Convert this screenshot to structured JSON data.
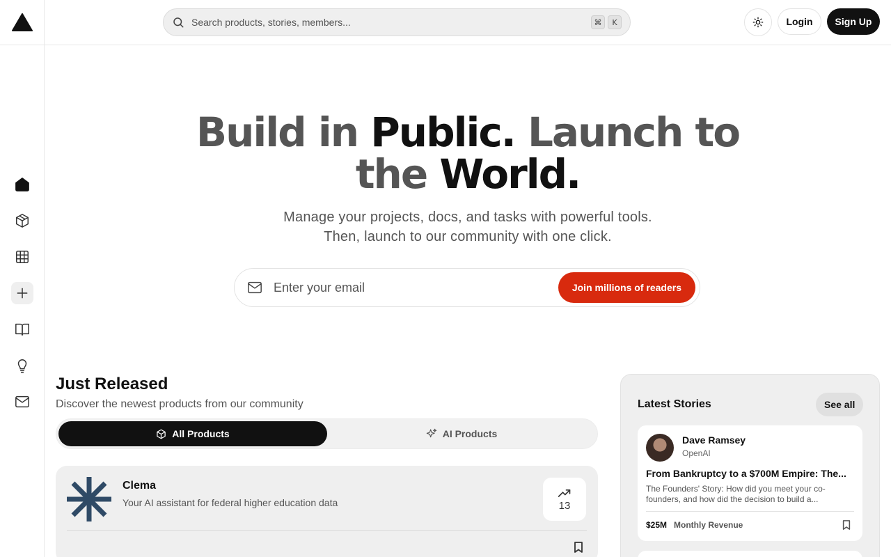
{
  "header": {
    "search_placeholder": "Search products, stories, members...",
    "shortcut_cmd": "⌘",
    "shortcut_key": "K",
    "login_label": "Login",
    "signup_label": "Sign Up"
  },
  "sidebar": {
    "items": [
      {
        "icon": "home-icon"
      },
      {
        "icon": "box-icon"
      },
      {
        "icon": "grid-icon"
      },
      {
        "icon": "plus-icon"
      },
      {
        "icon": "book-icon"
      },
      {
        "icon": "lightbulb-icon"
      },
      {
        "icon": "mail-icon"
      }
    ]
  },
  "hero": {
    "title_part1": "Build in ",
    "title_part2": "Public.",
    "title_part3": " Launch to",
    "title_part4": "the ",
    "title_part5": "World.",
    "subtitle_line1": "Manage your projects, docs, and tasks with powerful tools.",
    "subtitle_line2": "Then, launch to our community with one click.",
    "email_placeholder": "Enter your email",
    "cta_label": "Join millions of readers"
  },
  "just_released": {
    "title": "Just Released",
    "subtitle": "Discover the newest products from our community",
    "tabs": [
      {
        "label": "All Products",
        "active": true
      },
      {
        "label": "AI Products",
        "active": false
      }
    ],
    "products": [
      {
        "name": "Clema",
        "tagline": "Your AI assistant for federal higher education data",
        "upvotes": "13"
      }
    ]
  },
  "stories": {
    "title": "Latest Stories",
    "see_all_label": "See all",
    "items": [
      {
        "author": "Dave Ramsey",
        "company": "OpenAI",
        "title": "From Bankruptcy to a $700M Empire: The...",
        "excerpt": "The Founders' Story: How did you meet your co-founders, and how did the decision to build a...",
        "revenue": "$25M",
        "revenue_label": "Monthly Revenue"
      }
    ]
  },
  "colors": {
    "accent": "#d82a0e",
    "dark": "#111111",
    "logo_blue": "#2f4a66"
  }
}
